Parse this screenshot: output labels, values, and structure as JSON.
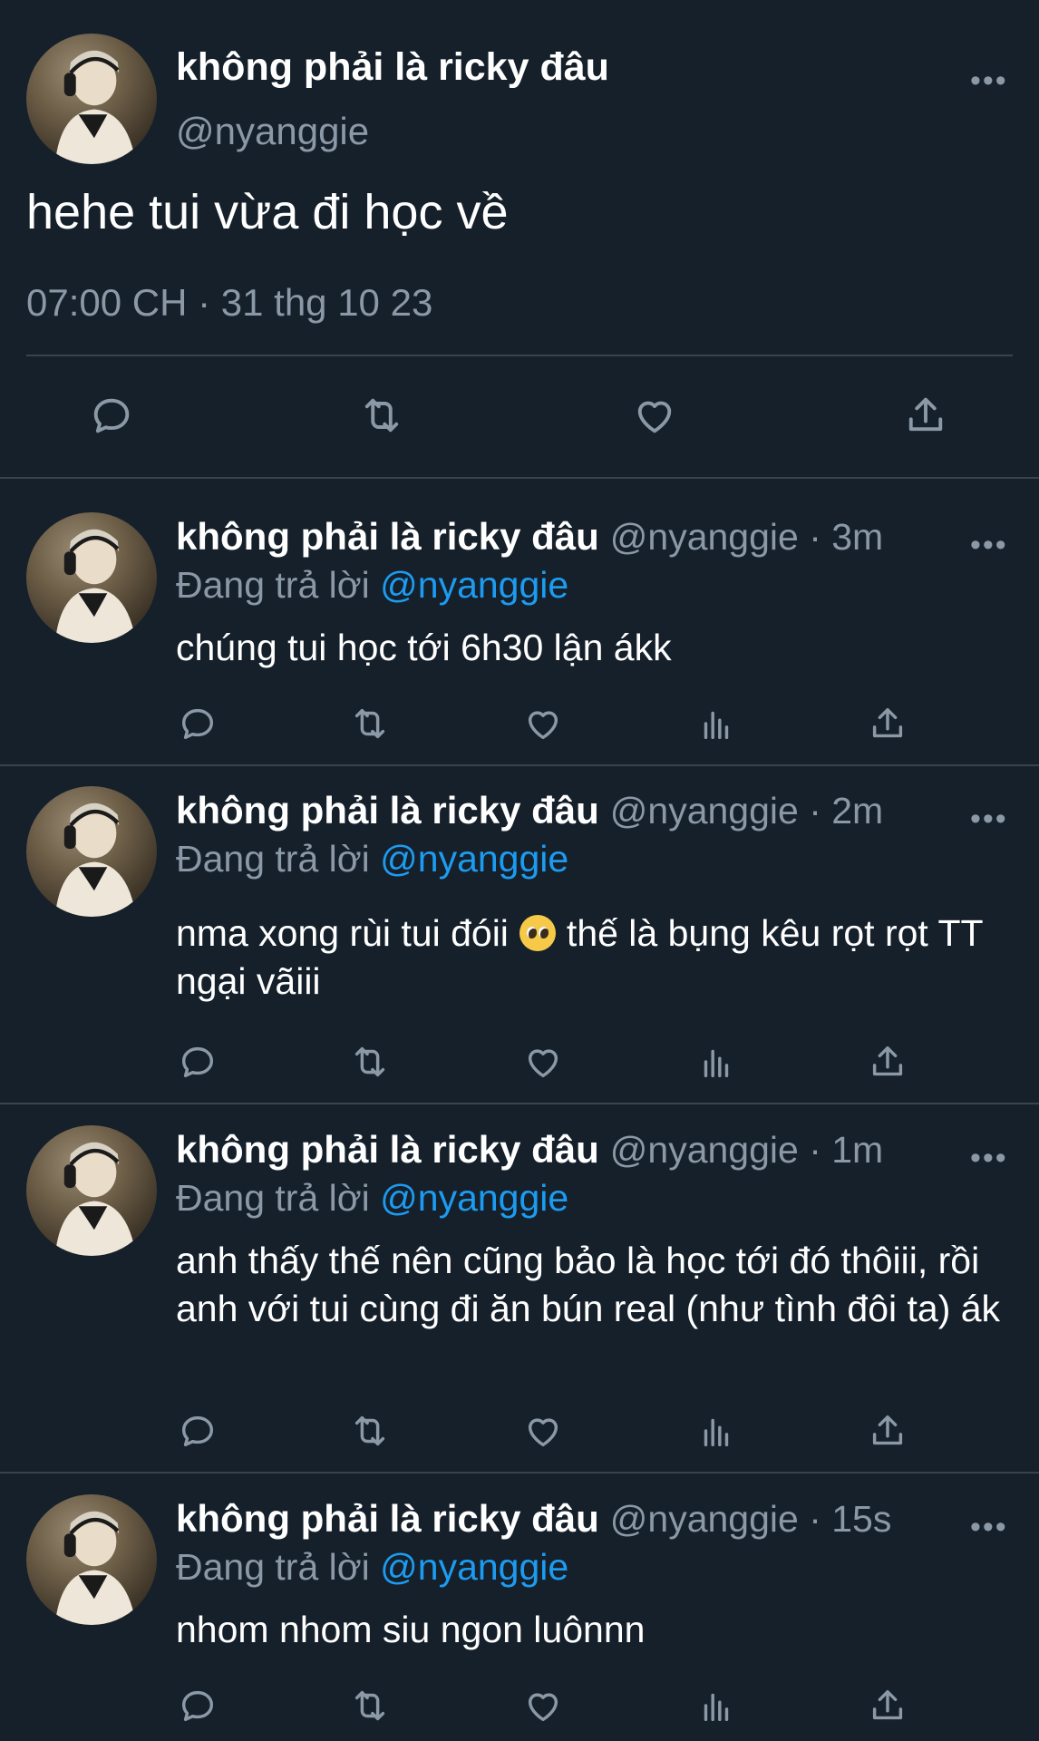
{
  "main_tweet": {
    "display_name": "không phải là ricky đâu",
    "handle": "@nyanggie",
    "text": "hehe tui vừa đi học về",
    "timestamp": "07:00 CH · 31 thg 10 23"
  },
  "replies": [
    {
      "display_name": "không phải là ricky đâu",
      "handle_time": "@nyanggie · 3m",
      "replying_label": "Đang trả lời",
      "mention": "@nyanggie",
      "text": "chúng tui học tới 6h30 lận ákk"
    },
    {
      "display_name": "không phải là ricky đâu",
      "handle_time": "@nyanggie · 2m",
      "replying_label": "Đang trả lời",
      "mention": "@nyanggie",
      "text_part1": "nma xong rùi tui đóii",
      "text_part2": "thế là bụng kêu rọt rọt TT ngại vãiii"
    },
    {
      "display_name": "không phải là ricky đâu",
      "handle_time": "@nyanggie · 1m",
      "replying_label": "Đang trả lời",
      "mention": "@nyanggie",
      "text": "anh thấy thế nên cũng bảo là học tới đó thôiii, rồi anh với tui cùng đi ăn bún real (như tình đôi ta) ák"
    },
    {
      "display_name": "không phải là ricky đâu",
      "handle_time": "@nyanggie · 15s",
      "replying_label": "Đang trả lời",
      "mention": "@nyanggie",
      "text": "nhom nhom siu ngon luônnn"
    }
  ],
  "more_label": "•••",
  "colors": {
    "background": "#15202b",
    "text": "#ffffff",
    "muted": "#8b98a5",
    "link": "#1d9bf0",
    "divider": "#38444d"
  },
  "icons": {
    "reply": "reply-icon",
    "retweet": "retweet-icon",
    "like": "heart-icon",
    "views": "analytics-icon",
    "share": "share-icon",
    "more": "more-icon"
  }
}
